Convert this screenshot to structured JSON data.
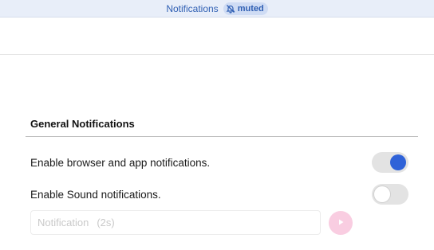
{
  "topbar": {
    "title": "Notifications",
    "badge_icon": "muted-bell-icon",
    "badge_label": "muted"
  },
  "section": {
    "title": "General Notifications"
  },
  "settings": {
    "browser_notifications": {
      "label": "Enable browser and app notifications.",
      "enabled": true
    },
    "sound_notifications": {
      "label": "Enable Sound notifications.",
      "enabled": false
    }
  },
  "sound_select": {
    "value": "Notification",
    "duration": "(2s)",
    "play_icon": "play-icon"
  },
  "colors": {
    "accent_blue": "#2f62d8",
    "topbar_bg": "#e8eef9",
    "play_button_bg": "#f9cde1"
  }
}
